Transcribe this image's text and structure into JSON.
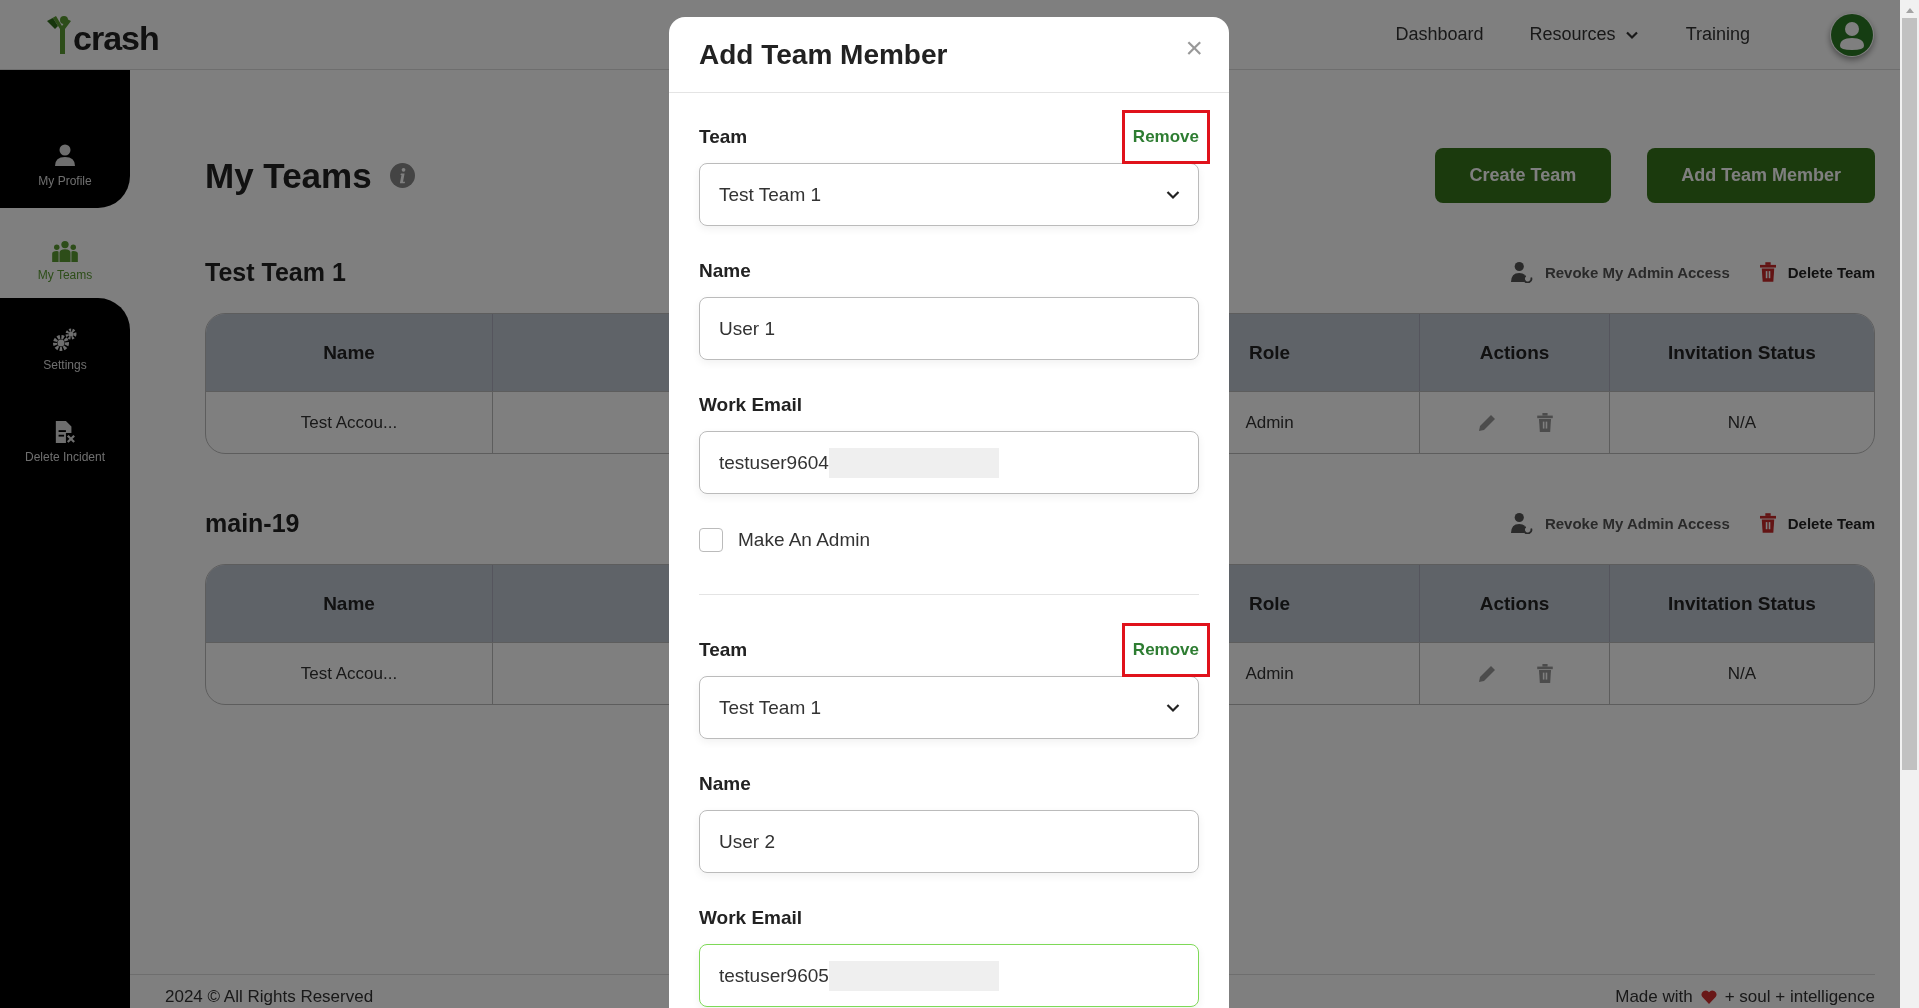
{
  "logo": {
    "text": "crash"
  },
  "nav": [
    {
      "label": "Dashboard",
      "kind": "link"
    },
    {
      "label": "Resources",
      "kind": "dropdown"
    },
    {
      "label": "Training",
      "kind": "link"
    }
  ],
  "sidebar": {
    "items": [
      {
        "label": "My Profile",
        "kind": "profile",
        "selected": false
      },
      {
        "label": "My Teams",
        "kind": "teams",
        "selected": true
      },
      {
        "label": "Settings",
        "kind": "settings",
        "selected": false
      },
      {
        "label": "Delete Incident",
        "kind": "delete",
        "selected": false
      }
    ]
  },
  "page": {
    "title": "My Teams",
    "buttons": [
      "Create Team",
      "Add Team Member"
    ]
  },
  "teams": [
    {
      "name": "Test Team 1",
      "actions": [
        {
          "label": "Revoke My Admin Access",
          "kind": "revoke"
        },
        {
          "label": "Delete Team",
          "kind": "delete"
        }
      ],
      "table": {
        "columns": [
          "Name",
          "Role",
          "Actions",
          "Invitation Status"
        ],
        "rows": [
          {
            "name": "Test Accou...",
            "role": "Admin",
            "status": "N/A"
          }
        ]
      }
    },
    {
      "name": "main-19",
      "actions": [
        {
          "label": "Revoke My Admin Access",
          "kind": "revoke"
        },
        {
          "label": "Delete Team",
          "kind": "delete"
        }
      ],
      "table": {
        "columns": [
          "Name",
          "Role",
          "Actions",
          "Invitation Status"
        ],
        "rows": [
          {
            "name": "Test Accou...",
            "role": "Admin",
            "status": "N/A"
          }
        ]
      }
    }
  ],
  "footer": {
    "copyright": "2024 © All Rights Reserved",
    "made_with": "Made with",
    "tagline": "+ soul + intelligence"
  },
  "modal": {
    "title": "Add Team Member",
    "close": "×",
    "members": [
      {
        "team_label": "Team",
        "remove": "Remove",
        "remove_highlighted": true,
        "team": "Test Team 1",
        "name_label": "Name",
        "name": "User 1",
        "email_label": "Work Email",
        "email": "testuser9604",
        "email_focused": false,
        "admin_label": "Make An Admin",
        "admin_checked": false
      },
      {
        "team_label": "Team",
        "remove": "Remove",
        "remove_highlighted": true,
        "team": "Test Team 1",
        "name_label": "Name",
        "name": "User 2",
        "email_label": "Work Email",
        "email": "testuser9605",
        "email_focused": true
      }
    ]
  }
}
